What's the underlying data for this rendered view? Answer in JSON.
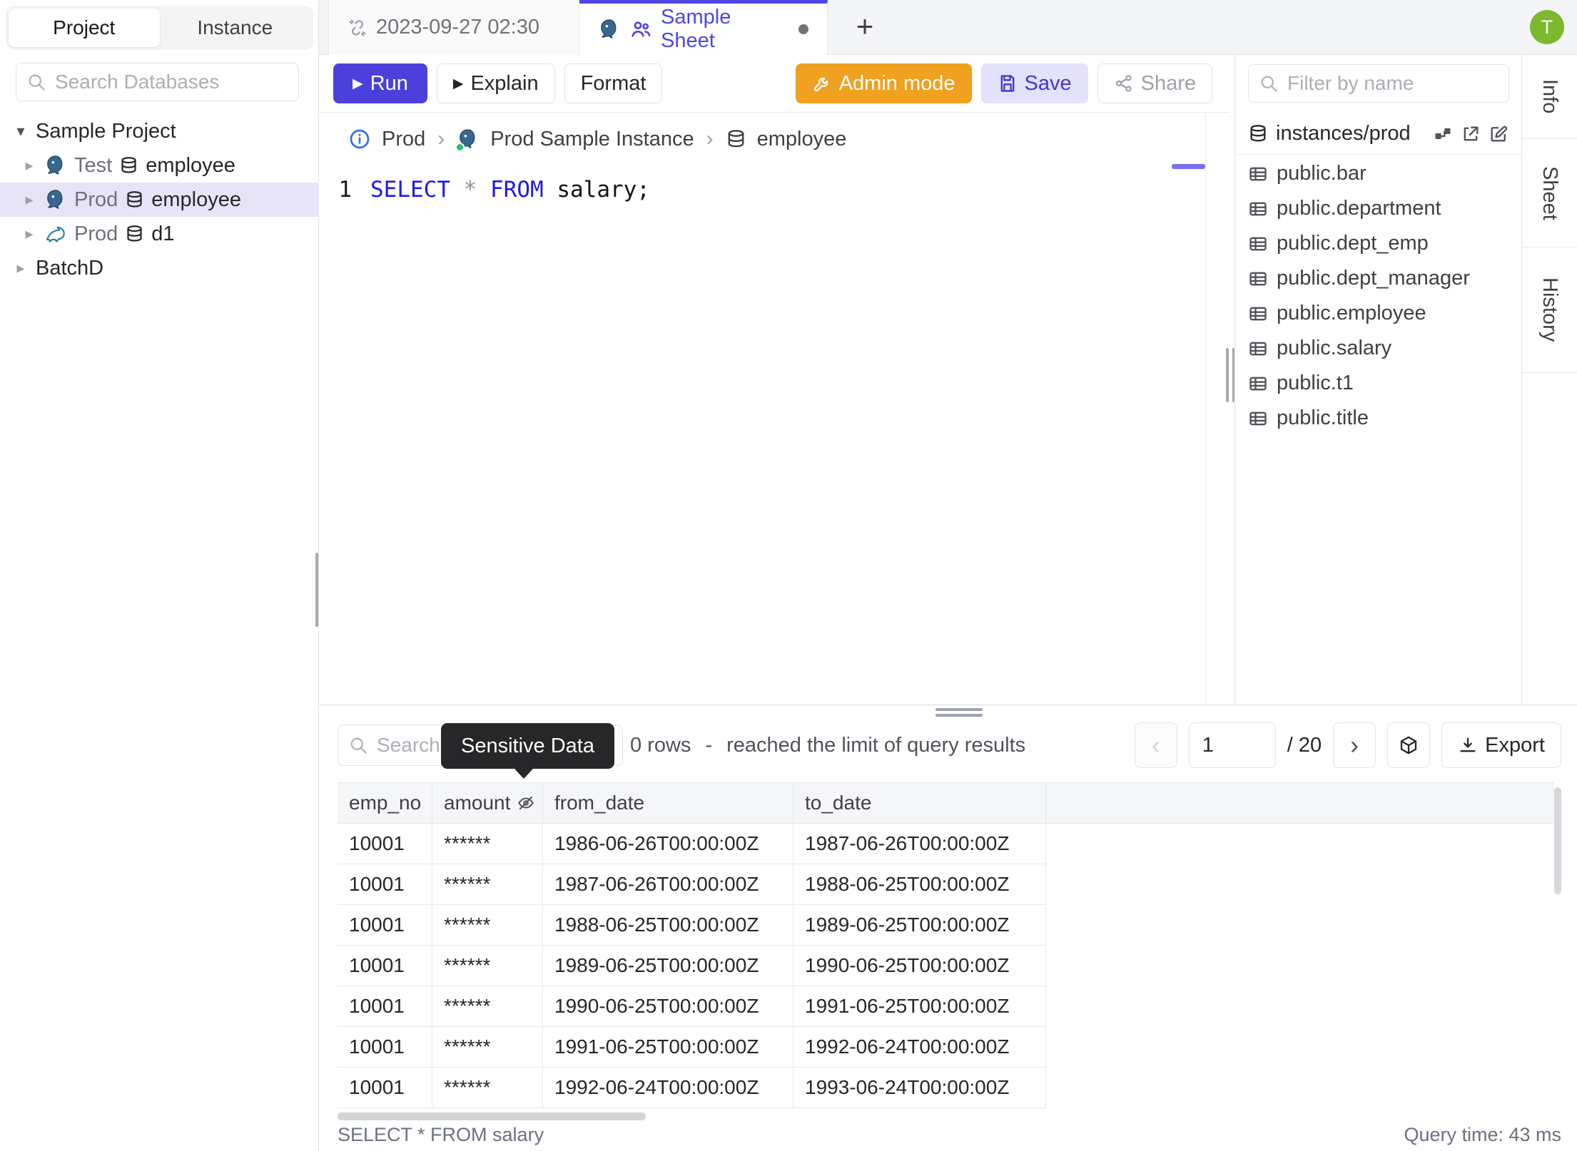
{
  "icons": {
    "caret_down": "▾",
    "caret_right": "▸",
    "chevron_right": "›",
    "play": "▶",
    "plus": "+",
    "prev": "‹",
    "next": "›"
  },
  "account": {
    "avatar_initial": "T"
  },
  "left_sidebar": {
    "tabs": {
      "project": "Project",
      "instance": "Instance"
    },
    "search_placeholder": "Search Databases",
    "tree": {
      "project_root": "Sample Project",
      "nodes": [
        {
          "env": "Test",
          "engine": "postgres",
          "database": "employee",
          "selected": false
        },
        {
          "env": "Prod",
          "engine": "postgres",
          "database": "employee",
          "selected": true
        },
        {
          "env": "Prod",
          "engine": "mysql",
          "database": "d1",
          "selected": false
        }
      ],
      "batch_root": "BatchD"
    }
  },
  "tab_bar": {
    "tab1_label": "2023-09-27 02:30",
    "tab2_label": "Sample Sheet",
    "new_tab": "+"
  },
  "toolbar": {
    "run": "Run",
    "explain": "Explain",
    "format": "Format",
    "admin_mode": "Admin mode",
    "save": "Save",
    "share": "Share"
  },
  "breadcrumb": {
    "environment": "Prod",
    "instance": "Prod Sample Instance",
    "database": "employee"
  },
  "editor": {
    "line_number": "1",
    "tokens": {
      "select": "SELECT",
      "star": "*",
      "from": "FROM",
      "rest": "salary;"
    }
  },
  "right_sidebar": {
    "filter_placeholder": "Filter by name",
    "schema_header": "instances/prod",
    "tables": [
      "public.bar",
      "public.department",
      "public.dept_emp",
      "public.dept_manager",
      "public.employee",
      "public.salary",
      "public.t1",
      "public.title"
    ]
  },
  "side_tabs": {
    "info": "Info",
    "sheet": "Sheet",
    "history": "History"
  },
  "results": {
    "search_placeholder": "Search",
    "tooltip": "Sensitive Data",
    "summary": {
      "rows": "0 rows",
      "dash": "-",
      "note": "reached the limit of query results"
    },
    "pagination": {
      "page": "1",
      "total": "/ 20"
    },
    "export": "Export",
    "table": {
      "columns": [
        "emp_no",
        "amount",
        "from_date",
        "to_date"
      ],
      "masked_column": "amount",
      "rows": [
        [
          "10001",
          "******",
          "1986-06-26T00:00:00Z",
          "1987-06-26T00:00:00Z"
        ],
        [
          "10001",
          "******",
          "1987-06-26T00:00:00Z",
          "1988-06-25T00:00:00Z"
        ],
        [
          "10001",
          "******",
          "1988-06-25T00:00:00Z",
          "1989-06-25T00:00:00Z"
        ],
        [
          "10001",
          "******",
          "1989-06-25T00:00:00Z",
          "1990-06-25T00:00:00Z"
        ],
        [
          "10001",
          "******",
          "1990-06-25T00:00:00Z",
          "1991-06-25T00:00:00Z"
        ],
        [
          "10001",
          "******",
          "1991-06-25T00:00:00Z",
          "1992-06-24T00:00:00Z"
        ],
        [
          "10001",
          "******",
          "1992-06-24T00:00:00Z",
          "1993-06-24T00:00:00Z"
        ]
      ]
    },
    "status": {
      "query": "SELECT * FROM salary",
      "time": "Query time: 43 ms"
    }
  },
  "colors": {
    "accent_indigo": "#4f46e5",
    "run_button": "#4c40dc",
    "admin_orange": "#efa11f",
    "save_bg": "#e3e1fb",
    "save_text": "#4634d0",
    "selected_row": "#e7e4f8",
    "avatar_green": "#7cb92c",
    "keyword_blue": "#1f18ec",
    "tooltip_bg": "#27272a",
    "postgres_blue": "#39678f",
    "mysql_teal": "#2e7f9e",
    "status_green": "#2fbe62"
  }
}
